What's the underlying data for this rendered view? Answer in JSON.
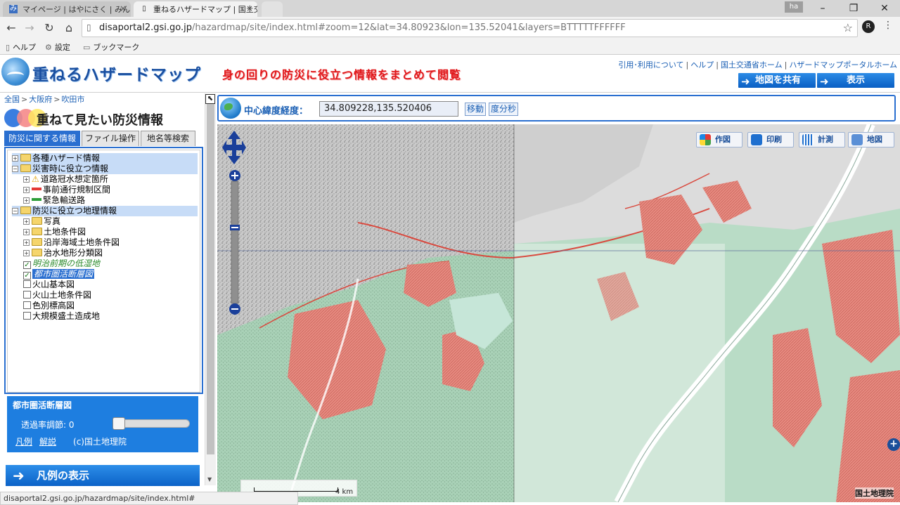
{
  "browser": {
    "tabs": [
      {
        "title": "マイページ | はやにさく | みん",
        "active": false
      },
      {
        "title": "重ねるハザードマップ | 国土交",
        "active": true
      }
    ],
    "user_badge": "ha",
    "url_host": "disaportal2.gsi.go.jp",
    "url_path": "/hazardmap/site/index.html#zoom=12&lat=34.80923&lon=135.52041&layers=BTTTTTFFFFFF",
    "bookmarks": [
      "ヘルプ",
      "設定",
      "ブックマーク"
    ],
    "status_text": "disaportal2.gsi.go.jp/hazardmap/site/index.html#"
  },
  "header": {
    "title": "重ねるハザードマップ",
    "subtitle": "身の回りの防災に役立つ情報をまとめて閲覧",
    "links": [
      "引用･利用について",
      "ヘルプ",
      "国土交通省ホーム",
      "ハザードマップポータルホーム"
    ],
    "share_button": "地図を共有",
    "display_button": "表示"
  },
  "sidebar": {
    "breadcrumb": [
      "全国",
      "大阪府",
      "吹田市"
    ],
    "panel_title": "重ねて見たい防災情報",
    "tabs": [
      "防災に関する情報",
      "ファイル操作",
      "地名等検索"
    ],
    "tree": [
      {
        "label": "各種ハザード情報",
        "type": "folder",
        "level": 0,
        "expander": "+",
        "highlight": true
      },
      {
        "label": "災害時に役立つ情報",
        "type": "folder",
        "level": 0,
        "expander": "−",
        "highlight": true
      },
      {
        "label": "道路冠水想定箇所",
        "type": "warn",
        "level": 1,
        "expander": "+"
      },
      {
        "label": "事前通行規制区間",
        "type": "red-line",
        "level": 1,
        "expander": "+"
      },
      {
        "label": "緊急輸送路",
        "type": "green-line",
        "level": 1,
        "expander": "+"
      },
      {
        "label": "防災に役立つ地理情報",
        "type": "folder",
        "level": 0,
        "expander": "−",
        "highlight": true
      },
      {
        "label": "写真",
        "type": "folder",
        "level": 1,
        "expander": "+"
      },
      {
        "label": "土地条件図",
        "type": "folder",
        "level": 1,
        "expander": "+"
      },
      {
        "label": "沿岸海域土地条件図",
        "type": "folder",
        "level": 1,
        "expander": "+"
      },
      {
        "label": "治水地形分類図",
        "type": "folder",
        "level": 1,
        "expander": "+"
      },
      {
        "label": "明治前期の低湿地",
        "type": "checked-green",
        "level": 1
      },
      {
        "label": "都市圏活断層図",
        "type": "checked-selected",
        "level": 1
      },
      {
        "label": "火山基本図",
        "type": "unchecked",
        "level": 1
      },
      {
        "label": "火山土地条件図",
        "type": "unchecked",
        "level": 1
      },
      {
        "label": "色別標高図",
        "type": "unchecked",
        "level": 1
      },
      {
        "label": "大規模盛土造成地",
        "type": "unchecked",
        "level": 1
      }
    ],
    "layer_panel": {
      "title": "都市圏活断層図",
      "transparency_label": "透過率調節: 0",
      "transparency_value": 0,
      "legend_link": "凡例",
      "explain_link": "解説",
      "copyright": "(c)国土地理院"
    },
    "legend_button": "凡例の表示"
  },
  "map": {
    "coord_label": "中心緯度経度：",
    "coord_value": "34.809228,135.520406",
    "move_button": "移動",
    "dms_button": "度分秒",
    "tools": [
      "作図",
      "印刷",
      "計測",
      "地図"
    ],
    "scale_label": "4 km",
    "attribution": "国土地理院",
    "colors": {
      "greenland": "#b7d8c3",
      "hazard": "#e2837a",
      "river": "#ffffff",
      "accent": "#2a6fd0"
    }
  }
}
